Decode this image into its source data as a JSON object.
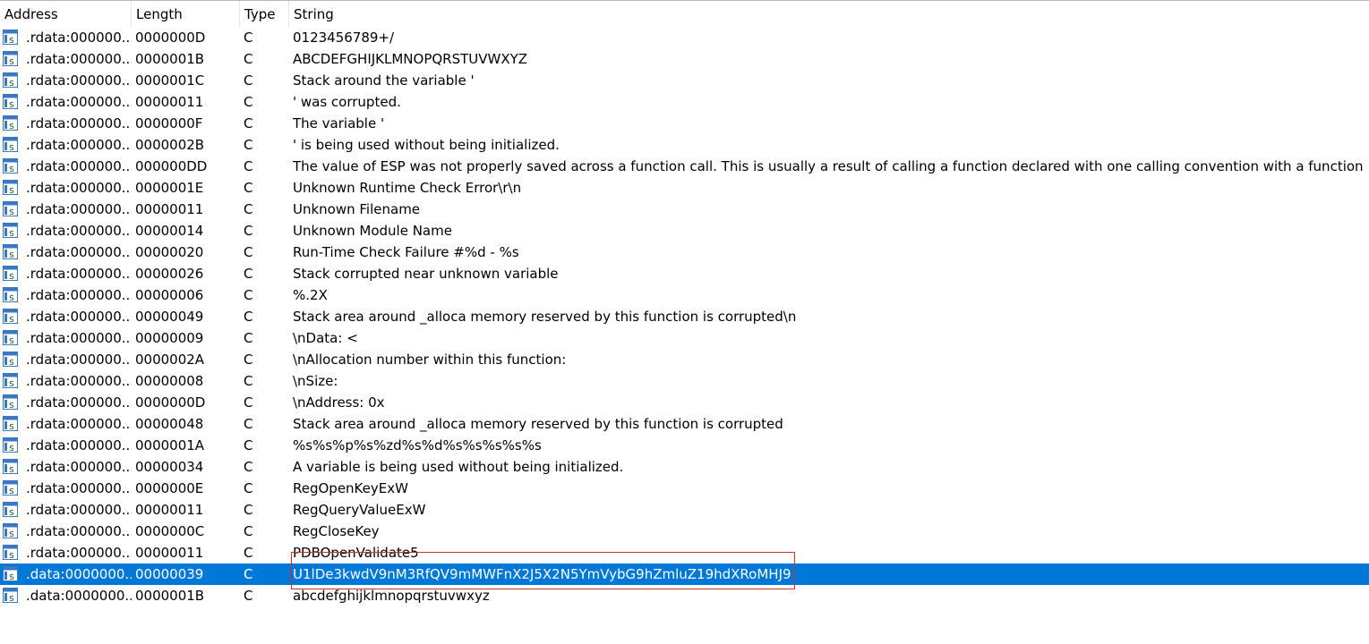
{
  "columns": {
    "address": "Address",
    "length": "Length",
    "type": "Type",
    "string": "String"
  },
  "row_icon": "string-icon",
  "colors": {
    "selection": "#0078d7",
    "highlight_box": "#d32f2f"
  },
  "rows": [
    {
      "address": ".rdata:000000...",
      "length": "0000000D",
      "type": "C",
      "string": "0123456789+/"
    },
    {
      "address": ".rdata:000000...",
      "length": "0000001B",
      "type": "C",
      "string": "ABCDEFGHIJKLMNOPQRSTUVWXYZ"
    },
    {
      "address": ".rdata:000000...",
      "length": "0000001C",
      "type": "C",
      "string": "Stack around the variable '"
    },
    {
      "address": ".rdata:000000...",
      "length": "00000011",
      "type": "C",
      "string": "' was corrupted."
    },
    {
      "address": ".rdata:000000...",
      "length": "0000000F",
      "type": "C",
      "string": "The variable '"
    },
    {
      "address": ".rdata:000000...",
      "length": "0000002B",
      "type": "C",
      "string": "' is being used without being initialized."
    },
    {
      "address": ".rdata:000000...",
      "length": "000000DD",
      "type": "C",
      "string": "The value of ESP was not properly saved across a function call.  This is usually a result of calling a function declared with one calling convention with a function point..."
    },
    {
      "address": ".rdata:000000...",
      "length": "0000001E",
      "type": "C",
      "string": "Unknown Runtime Check Error\\r\\n"
    },
    {
      "address": ".rdata:000000...",
      "length": "00000011",
      "type": "C",
      "string": "Unknown Filename"
    },
    {
      "address": ".rdata:000000...",
      "length": "00000014",
      "type": "C",
      "string": "Unknown Module Name"
    },
    {
      "address": ".rdata:000000...",
      "length": "00000020",
      "type": "C",
      "string": "Run-Time Check Failure #%d - %s"
    },
    {
      "address": ".rdata:000000...",
      "length": "00000026",
      "type": "C",
      "string": "Stack corrupted near unknown variable"
    },
    {
      "address": ".rdata:000000...",
      "length": "00000006",
      "type": "C",
      "string": "%.2X"
    },
    {
      "address": ".rdata:000000...",
      "length": "00000049",
      "type": "C",
      "string": "Stack area around _alloca memory reserved by this function is corrupted\\n"
    },
    {
      "address": ".rdata:000000...",
      "length": "00000009",
      "type": "C",
      "string": "\\nData: <"
    },
    {
      "address": ".rdata:000000...",
      "length": "0000002A",
      "type": "C",
      "string": "\\nAllocation number within this function:"
    },
    {
      "address": ".rdata:000000...",
      "length": "00000008",
      "type": "C",
      "string": "\\nSize:"
    },
    {
      "address": ".rdata:000000...",
      "length": "0000000D",
      "type": "C",
      "string": "\\nAddress: 0x"
    },
    {
      "address": ".rdata:000000...",
      "length": "00000048",
      "type": "C",
      "string": "Stack area around _alloca memory reserved by this function is corrupted"
    },
    {
      "address": ".rdata:000000...",
      "length": "0000001A",
      "type": "C",
      "string": "%s%s%p%s%zd%s%d%s%s%s%s%s"
    },
    {
      "address": ".rdata:000000...",
      "length": "00000034",
      "type": "C",
      "string": "A variable is being used without being initialized."
    },
    {
      "address": ".rdata:000000...",
      "length": "0000000E",
      "type": "C",
      "string": "RegOpenKeyExW"
    },
    {
      "address": ".rdata:000000...",
      "length": "00000011",
      "type": "C",
      "string": "RegQueryValueExW"
    },
    {
      "address": ".rdata:000000...",
      "length": "0000000C",
      "type": "C",
      "string": "RegCloseKey"
    },
    {
      "address": ".rdata:000000...",
      "length": "00000011",
      "type": "C",
      "string": "PDBOpenValidate5"
    },
    {
      "address": ".data:0000000...",
      "length": "00000039",
      "type": "C",
      "string": "U1lDe3kwdV9nM3RfQV9mMWFnX2J5X2N5YmVybG9hZmluZ19hdXRoMHJ9",
      "selected": true
    },
    {
      "address": ".data:0000000...",
      "length": "0000001B",
      "type": "C",
      "string": "abcdefghijklmnopqrstuvwxyz"
    }
  ]
}
